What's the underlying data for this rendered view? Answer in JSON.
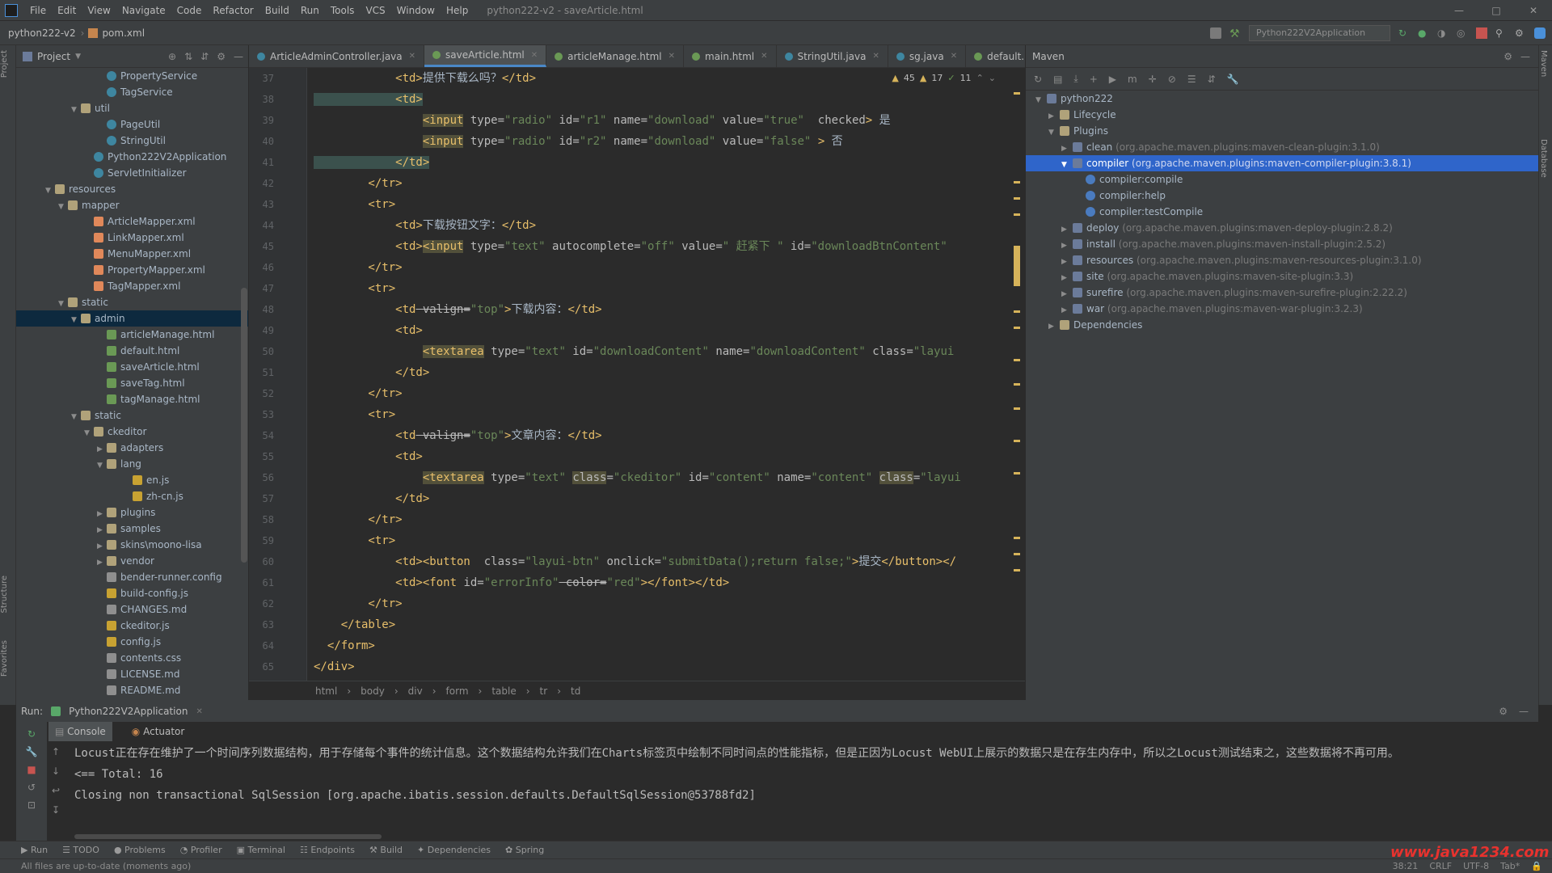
{
  "menubar": {
    "items": [
      "File",
      "Edit",
      "View",
      "Navigate",
      "Code",
      "Refactor",
      "Build",
      "Run",
      "Tools",
      "VCS",
      "Window",
      "Help"
    ],
    "window_title": "python222-v2 - saveArticle.html"
  },
  "navbar": {
    "project": "python222-v2",
    "file": "pom.xml",
    "run_config": "Python222V2Application"
  },
  "project_panel": {
    "title": "Project",
    "rows": [
      {
        "indent": 6,
        "arrow": "",
        "icon": "class",
        "label": "PropertyService"
      },
      {
        "indent": 6,
        "arrow": "",
        "icon": "class",
        "label": "TagService"
      },
      {
        "indent": 4,
        "arrow": "v",
        "icon": "folder",
        "label": "util"
      },
      {
        "indent": 6,
        "arrow": "",
        "icon": "class",
        "label": "PageUtil"
      },
      {
        "indent": 6,
        "arrow": "",
        "icon": "class",
        "label": "StringUtil"
      },
      {
        "indent": 5,
        "arrow": "",
        "icon": "class",
        "label": "Python222V2Application"
      },
      {
        "indent": 5,
        "arrow": "",
        "icon": "class",
        "label": "ServletInitializer"
      },
      {
        "indent": 2,
        "arrow": "v",
        "icon": "folder",
        "label": "resources"
      },
      {
        "indent": 3,
        "arrow": "v",
        "icon": "folder",
        "label": "mapper"
      },
      {
        "indent": 5,
        "arrow": "",
        "icon": "xml",
        "label": "ArticleMapper.xml"
      },
      {
        "indent": 5,
        "arrow": "",
        "icon": "xml",
        "label": "LinkMapper.xml"
      },
      {
        "indent": 5,
        "arrow": "",
        "icon": "xml",
        "label": "MenuMapper.xml"
      },
      {
        "indent": 5,
        "arrow": "",
        "icon": "xml",
        "label": "PropertyMapper.xml"
      },
      {
        "indent": 5,
        "arrow": "",
        "icon": "xml",
        "label": "TagMapper.xml"
      },
      {
        "indent": 3,
        "arrow": "v",
        "icon": "folder",
        "label": "static"
      },
      {
        "indent": 4,
        "arrow": "v",
        "icon": "folder",
        "label": "admin",
        "selected": true
      },
      {
        "indent": 6,
        "arrow": "",
        "icon": "html",
        "label": "articleManage.html"
      },
      {
        "indent": 6,
        "arrow": "",
        "icon": "html",
        "label": "default.html"
      },
      {
        "indent": 6,
        "arrow": "",
        "icon": "html",
        "label": "saveArticle.html"
      },
      {
        "indent": 6,
        "arrow": "",
        "icon": "html",
        "label": "saveTag.html"
      },
      {
        "indent": 6,
        "arrow": "",
        "icon": "html",
        "label": "tagManage.html"
      },
      {
        "indent": 4,
        "arrow": "v",
        "icon": "folder",
        "label": "static"
      },
      {
        "indent": 5,
        "arrow": "v",
        "icon": "folder",
        "label": "ckeditor"
      },
      {
        "indent": 6,
        "arrow": ">",
        "icon": "folder",
        "label": "adapters"
      },
      {
        "indent": 6,
        "arrow": "v",
        "icon": "folder",
        "label": "lang"
      },
      {
        "indent": 8,
        "arrow": "",
        "icon": "js",
        "label": "en.js"
      },
      {
        "indent": 8,
        "arrow": "",
        "icon": "js",
        "label": "zh-cn.js"
      },
      {
        "indent": 6,
        "arrow": ">",
        "icon": "folder",
        "label": "plugins"
      },
      {
        "indent": 6,
        "arrow": ">",
        "icon": "folder",
        "label": "samples"
      },
      {
        "indent": 6,
        "arrow": ">",
        "icon": "folder",
        "label": "skins\\moono-lisa"
      },
      {
        "indent": 6,
        "arrow": ">",
        "icon": "folder",
        "label": "vendor"
      },
      {
        "indent": 6,
        "arrow": "",
        "icon": "file",
        "label": "bender-runner.config"
      },
      {
        "indent": 6,
        "arrow": "",
        "icon": "js",
        "label": "build-config.js"
      },
      {
        "indent": 6,
        "arrow": "",
        "icon": "file",
        "label": "CHANGES.md"
      },
      {
        "indent": 6,
        "arrow": "",
        "icon": "js",
        "label": "ckeditor.js"
      },
      {
        "indent": 6,
        "arrow": "",
        "icon": "js",
        "label": "config.js"
      },
      {
        "indent": 6,
        "arrow": "",
        "icon": "file",
        "label": "contents.css"
      },
      {
        "indent": 6,
        "arrow": "",
        "icon": "file",
        "label": "LICENSE.md"
      },
      {
        "indent": 6,
        "arrow": "",
        "icon": "file",
        "label": "README.md"
      }
    ]
  },
  "editor_tabs": [
    {
      "label": "ArticleAdminController.java",
      "dot": "#3e86a0",
      "active": false
    },
    {
      "label": "saveArticle.html",
      "dot": "#6a9955",
      "active": true
    },
    {
      "label": "articleManage.html",
      "dot": "#6a9955",
      "active": false
    },
    {
      "label": "main.html",
      "dot": "#6a9955",
      "active": false
    },
    {
      "label": "StringUtil.java",
      "dot": "#3e86a0",
      "active": false
    },
    {
      "label": "sg.java",
      "dot": "#3e86a0",
      "active": false
    },
    {
      "label": "default.ht",
      "dot": "#6a9955",
      "active": false
    }
  ],
  "inspections": {
    "warnings": "45",
    "weak": "17",
    "ok": "11"
  },
  "editor": {
    "line_numbers": [
      "37",
      "38",
      "39",
      "40",
      "41",
      "42",
      "43",
      "44",
      "45",
      "46",
      "47",
      "48",
      "49",
      "50",
      "51",
      "52",
      "53",
      "54",
      "55",
      "56",
      "57",
      "58",
      "59",
      "60",
      "61",
      "62",
      "63",
      "64",
      "65"
    ],
    "lines": [
      [
        {
          "c": "tg",
          "t": "            <td>"
        },
        {
          "c": "tx",
          "t": "提供下载么吗？"
        },
        {
          "c": "tg",
          "t": "</td>"
        }
      ],
      [
        {
          "c": "tg hl",
          "t": "            <td>"
        }
      ],
      [
        {
          "c": "tx",
          "t": "                "
        },
        {
          "c": "tg hlw",
          "t": "<input"
        },
        {
          "c": "at",
          "t": " type="
        },
        {
          "c": "st",
          "t": "\"radio\""
        },
        {
          "c": "at",
          "t": " id="
        },
        {
          "c": "st",
          "t": "\"r1\""
        },
        {
          "c": "at",
          "t": " name="
        },
        {
          "c": "st",
          "t": "\"download\""
        },
        {
          "c": "at",
          "t": " value="
        },
        {
          "c": "st",
          "t": "\"true\""
        },
        {
          "c": "at",
          "t": "  checked"
        },
        {
          "c": "tg",
          "t": ">"
        },
        {
          "c": "tx",
          "t": " 是"
        }
      ],
      [
        {
          "c": "tx",
          "t": "                "
        },
        {
          "c": "tg hlw",
          "t": "<input"
        },
        {
          "c": "at",
          "t": " type="
        },
        {
          "c": "st",
          "t": "\"radio\""
        },
        {
          "c": "at",
          "t": " id="
        },
        {
          "c": "st",
          "t": "\"r2\""
        },
        {
          "c": "at",
          "t": " name="
        },
        {
          "c": "st",
          "t": "\"download\""
        },
        {
          "c": "at",
          "t": " value="
        },
        {
          "c": "st",
          "t": "\"false\""
        },
        {
          "c": "at",
          "t": " "
        },
        {
          "c": "tg",
          "t": ">"
        },
        {
          "c": "tx",
          "t": " 否"
        }
      ],
      [
        {
          "c": "tg hl",
          "t": "            </td>"
        }
      ],
      [
        {
          "c": "tg",
          "t": "        </tr>"
        }
      ],
      [
        {
          "c": "tg",
          "t": "        <tr>"
        }
      ],
      [
        {
          "c": "tg",
          "t": "            <td>"
        },
        {
          "c": "tx",
          "t": "下载按钮文字："
        },
        {
          "c": "tg",
          "t": "</td>"
        }
      ],
      [
        {
          "c": "tg",
          "t": "            <td>"
        },
        {
          "c": "tg hlw",
          "t": "<input"
        },
        {
          "c": "at",
          "t": " type="
        },
        {
          "c": "st",
          "t": "\"text\""
        },
        {
          "c": "at",
          "t": " autocomplete="
        },
        {
          "c": "st",
          "t": "\"off\""
        },
        {
          "c": "at",
          "t": " value="
        },
        {
          "c": "st",
          "t": "\" 赶紧下 \""
        },
        {
          "c": "at",
          "t": " id="
        },
        {
          "c": "st",
          "t": "\"downloadBtnContent\""
        }
      ],
      [
        {
          "c": "tg",
          "t": "        </tr>"
        }
      ],
      [
        {
          "c": "tg",
          "t": "        <tr>"
        }
      ],
      [
        {
          "c": "tg",
          "t": "            <td"
        },
        {
          "c": "at strike",
          "t": " valign="
        },
        {
          "c": "st",
          "t": "\"top\""
        },
        {
          "c": "tg",
          "t": ">"
        },
        {
          "c": "tx",
          "t": "下载内容："
        },
        {
          "c": "tg",
          "t": "</td>"
        }
      ],
      [
        {
          "c": "tg",
          "t": "            <td>"
        }
      ],
      [
        {
          "c": "tx",
          "t": "                "
        },
        {
          "c": "tg hlw",
          "t": "<textarea"
        },
        {
          "c": "at",
          "t": " type="
        },
        {
          "c": "st",
          "t": "\"text\""
        },
        {
          "c": "at",
          "t": " id="
        },
        {
          "c": "st",
          "t": "\"downloadContent\""
        },
        {
          "c": "at",
          "t": " name="
        },
        {
          "c": "st",
          "t": "\"downloadContent\""
        },
        {
          "c": "at",
          "t": " class="
        },
        {
          "c": "st",
          "t": "\"layui"
        }
      ],
      [
        {
          "c": "tg",
          "t": "            </td>"
        }
      ],
      [
        {
          "c": "tg",
          "t": "        </tr>"
        }
      ],
      [
        {
          "c": "tg",
          "t": "        <tr>"
        }
      ],
      [
        {
          "c": "tg",
          "t": "            <td"
        },
        {
          "c": "at strike",
          "t": " valign="
        },
        {
          "c": "st",
          "t": "\"top\""
        },
        {
          "c": "tg",
          "t": ">"
        },
        {
          "c": "tx",
          "t": "文章内容："
        },
        {
          "c": "tg",
          "t": "</td>"
        }
      ],
      [
        {
          "c": "tg",
          "t": "            <td>"
        }
      ],
      [
        {
          "c": "tx",
          "t": "                "
        },
        {
          "c": "tg hlw",
          "t": "<textarea"
        },
        {
          "c": "at",
          "t": " type="
        },
        {
          "c": "st",
          "t": "\"text\""
        },
        {
          "c": "at",
          "t": " "
        },
        {
          "c": "at hlw",
          "t": "class"
        },
        {
          "c": "at",
          "t": "="
        },
        {
          "c": "st",
          "t": "\"ckeditor\""
        },
        {
          "c": "at",
          "t": " id="
        },
        {
          "c": "st",
          "t": "\"content\""
        },
        {
          "c": "at",
          "t": " name="
        },
        {
          "c": "st",
          "t": "\"content\""
        },
        {
          "c": "at",
          "t": " "
        },
        {
          "c": "at hlw",
          "t": "class"
        },
        {
          "c": "at",
          "t": "="
        },
        {
          "c": "st",
          "t": "\"layui"
        }
      ],
      [
        {
          "c": "tg",
          "t": "            </td>"
        }
      ],
      [
        {
          "c": "tg",
          "t": "        </tr>"
        }
      ],
      [
        {
          "c": "tg",
          "t": "        <tr>"
        }
      ],
      [
        {
          "c": "tg",
          "t": "            <td><button"
        },
        {
          "c": "at",
          "t": "  class="
        },
        {
          "c": "st",
          "t": "\"layui-btn\""
        },
        {
          "c": "at",
          "t": " onclick="
        },
        {
          "c": "st",
          "t": "\"submitData();return false;\""
        },
        {
          "c": "tg",
          "t": ">"
        },
        {
          "c": "tx",
          "t": "提交"
        },
        {
          "c": "tg",
          "t": "</button></"
        }
      ],
      [
        {
          "c": "tg",
          "t": "            <td><font"
        },
        {
          "c": "at",
          "t": " id="
        },
        {
          "c": "st",
          "t": "\"errorInfo\""
        },
        {
          "c": "at strike",
          "t": " color="
        },
        {
          "c": "st",
          "t": "\"red\""
        },
        {
          "c": "tg",
          "t": "></font></td>"
        }
      ],
      [
        {
          "c": "tg",
          "t": "        </tr>"
        }
      ],
      [
        {
          "c": "tg",
          "t": "    </table>"
        }
      ],
      [
        {
          "c": "tg",
          "t": "  </form>"
        }
      ],
      [
        {
          "c": "tg",
          "t": "</div>"
        }
      ]
    ],
    "breadcrumb": [
      "html",
      "body",
      "div",
      "form",
      "table",
      "tr",
      "td"
    ]
  },
  "maven": {
    "title": "Maven",
    "rows": [
      {
        "indent": 0,
        "arrow": "v",
        "icon": "mvn",
        "label": "python222",
        "extra": ""
      },
      {
        "indent": 1,
        "arrow": ">",
        "icon": "folder",
        "label": "Lifecycle",
        "extra": ""
      },
      {
        "indent": 1,
        "arrow": "v",
        "icon": "folder",
        "label": "Plugins",
        "extra": ""
      },
      {
        "indent": 2,
        "arrow": ">",
        "icon": "mvn",
        "label": "clean",
        "extra": " (org.apache.maven.plugins:maven-clean-plugin:3.1.0)"
      },
      {
        "indent": 2,
        "arrow": "v",
        "icon": "mvn",
        "label": "compiler",
        "extra": " (org.apache.maven.plugins:maven-compiler-plugin:3.8.1)",
        "selected": true
      },
      {
        "indent": 3,
        "arrow": "",
        "icon": "goal",
        "label": "compiler:compile",
        "extra": ""
      },
      {
        "indent": 3,
        "arrow": "",
        "icon": "goal",
        "label": "compiler:help",
        "extra": ""
      },
      {
        "indent": 3,
        "arrow": "",
        "icon": "goal",
        "label": "compiler:testCompile",
        "extra": ""
      },
      {
        "indent": 2,
        "arrow": ">",
        "icon": "mvn",
        "label": "deploy",
        "extra": " (org.apache.maven.plugins:maven-deploy-plugin:2.8.2)"
      },
      {
        "indent": 2,
        "arrow": ">",
        "icon": "mvn",
        "label": "install",
        "extra": " (org.apache.maven.plugins:maven-install-plugin:2.5.2)"
      },
      {
        "indent": 2,
        "arrow": ">",
        "icon": "mvn",
        "label": "resources",
        "extra": " (org.apache.maven.plugins:maven-resources-plugin:3.1.0)"
      },
      {
        "indent": 2,
        "arrow": ">",
        "icon": "mvn",
        "label": "site",
        "extra": " (org.apache.maven.plugins:maven-site-plugin:3.3)"
      },
      {
        "indent": 2,
        "arrow": ">",
        "icon": "mvn",
        "label": "surefire",
        "extra": " (org.apache.maven.plugins:maven-surefire-plugin:2.22.2)"
      },
      {
        "indent": 2,
        "arrow": ">",
        "icon": "mvn",
        "label": "war",
        "extra": " (org.apache.maven.plugins:maven-war-plugin:3.2.3)"
      },
      {
        "indent": 1,
        "arrow": ">",
        "icon": "folder",
        "label": "Dependencies",
        "extra": ""
      }
    ]
  },
  "run": {
    "label": "Run:",
    "config": "Python222V2Application",
    "tabs": [
      "Console",
      "Actuator"
    ],
    "lines": [
      "Locust正在存在维护了一个时间序列数据结构，用于存储每个事件的统计信息。这个数据结构允许我们在Charts标签页中绘制不同时间点的性能指标，但是正因为Locust WebUI上展示的数据只是在存生内存中，所以之Locust测试结束之，这些数据将不再可用。",
      "<==      Total: 16",
      "Closing non transactional SqlSession [org.apache.ibatis.session.defaults.DefaultSqlSession@53788fd2]"
    ]
  },
  "tool_tabs": [
    "Run",
    "TODO",
    "Problems",
    "Profiler",
    "Terminal",
    "Endpoints",
    "Build",
    "Dependencies",
    "Spring"
  ],
  "status": {
    "message": "All files are up-to-date (moments ago)",
    "position": "38:21",
    "line_sep": "CRLF",
    "encoding": "UTF-8",
    "indent": "Tab*"
  },
  "watermark": "www.java1234.com",
  "left_strip": [
    "Project",
    "Structure",
    "Favorites"
  ],
  "right_strip": [
    "Maven",
    "Database"
  ]
}
